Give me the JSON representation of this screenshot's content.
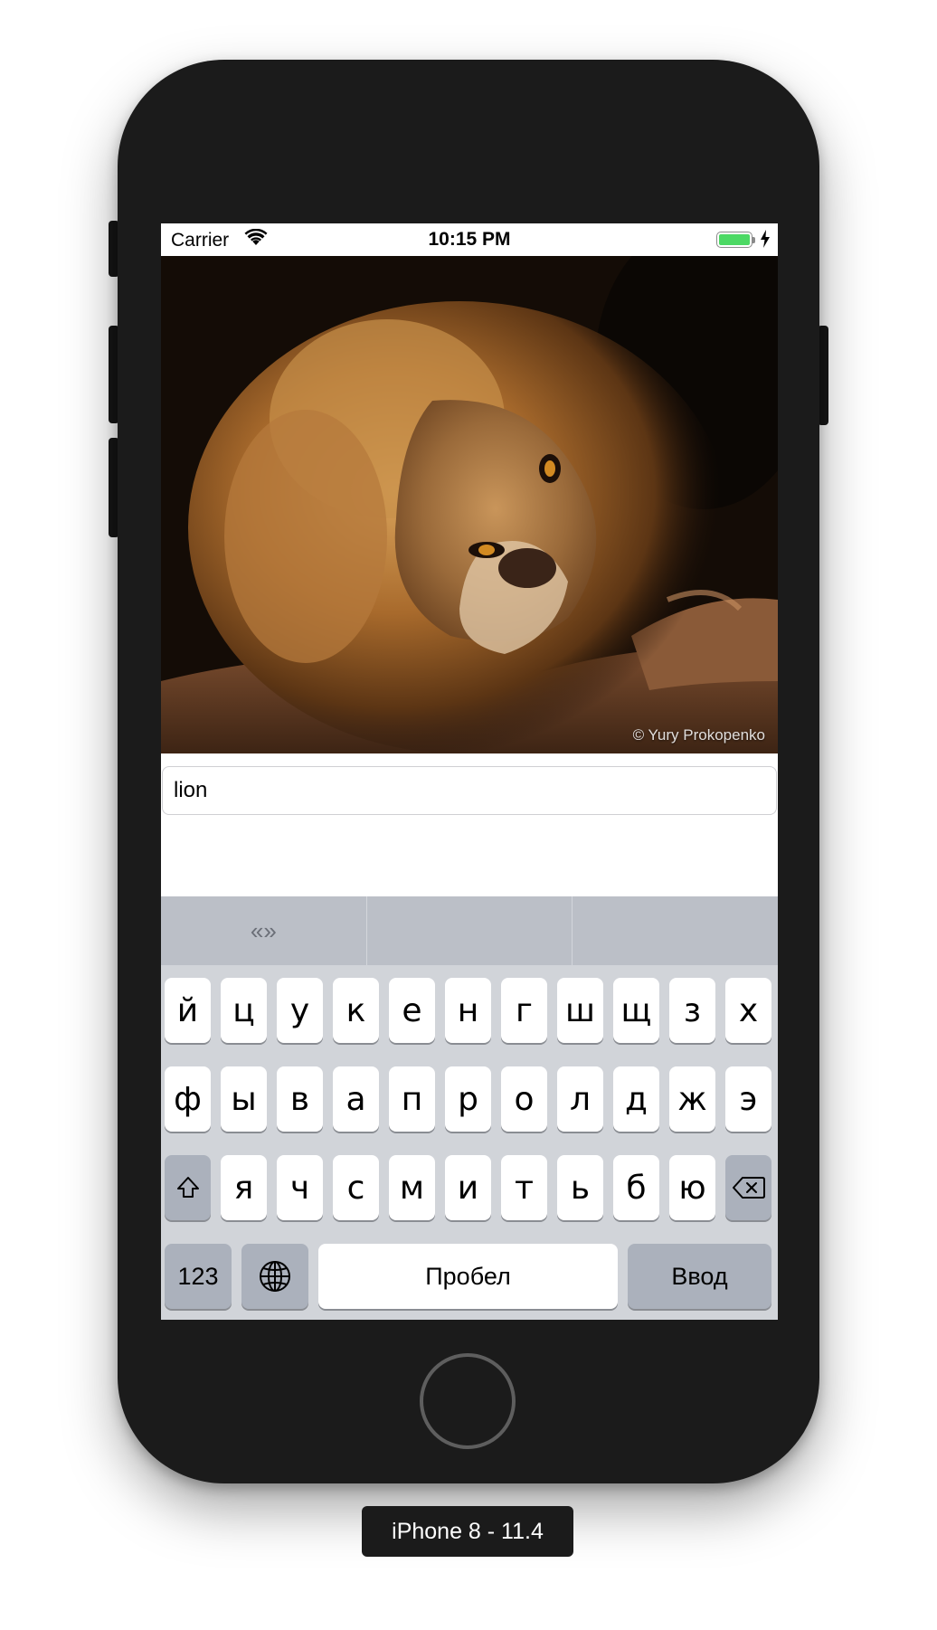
{
  "status_bar": {
    "carrier": "Carrier",
    "time": "10:15 PM"
  },
  "photo": {
    "credit": "© Yury Prokopenko"
  },
  "text_field": {
    "value": "lion"
  },
  "predictive_bar": {
    "suggestions": [
      "«»",
      "",
      ""
    ]
  },
  "keyboard": {
    "row1": [
      "й",
      "ц",
      "у",
      "к",
      "е",
      "н",
      "г",
      "ш",
      "щ",
      "з",
      "х"
    ],
    "row2": [
      "ф",
      "ы",
      "в",
      "а",
      "п",
      "р",
      "о",
      "л",
      "д",
      "ж",
      "э"
    ],
    "row3": [
      "я",
      "ч",
      "с",
      "м",
      "и",
      "т",
      "ь",
      "б",
      "ю"
    ],
    "numbers_label": "123",
    "space_label": "Пробел",
    "return_label": "Ввод"
  },
  "device_label": "iPhone 8 - 11.4",
  "colors": {
    "device_body": "#1b1b1b",
    "keyboard_bg": "#d1d4d9",
    "predictive_bg": "#bbbfc7",
    "special_key": "#abb1bc",
    "battery_fill": "#4cd964"
  }
}
